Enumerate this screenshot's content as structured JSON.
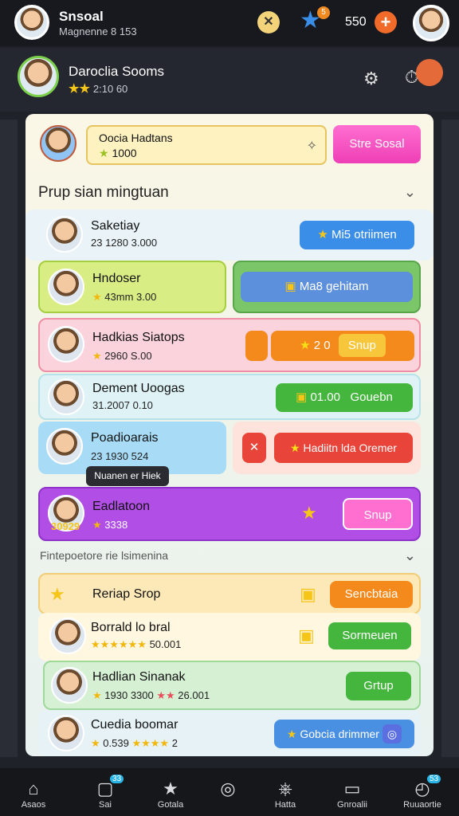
{
  "topbar": {
    "name": "Snsoal",
    "subtitle": "Magnenne 8 153",
    "close": "✕",
    "star_badge": "5",
    "coins": "550",
    "plus": "+"
  },
  "player": {
    "name": "Daroclia Sooms",
    "stars": "★★",
    "level": "2:10 60",
    "gear": "⚙",
    "timer": "⏱"
  },
  "panel": {
    "title": "Oocia Hadtans",
    "value": "1000",
    "send_button": "Stre Sosal"
  },
  "section1": {
    "title": "Prup sian mingtuan",
    "chevron": "⌄"
  },
  "rows": [
    {
      "name": "Saketiay",
      "sub": "23 1280 3.000",
      "button": "Mi5 otriimen"
    },
    {
      "name": "Hndoser",
      "sub": "43mm 3.00",
      "button": "Ma8 gehitam"
    },
    {
      "name": "Hadkias Siatops",
      "sub": "2960 S.00",
      "button": "Snup",
      "count": "2 0"
    },
    {
      "name": "Dement Uoogas",
      "sub": "31.2007 0.10",
      "button": "Gouebn",
      "count": "01.00"
    },
    {
      "name": "Poadioarais",
      "sub": "23 1930 524",
      "button": "Hadiitn lda Oremer",
      "tooltip": "Nuanen er Hiek"
    },
    {
      "name": "Eadlatoon",
      "sub": "3338",
      "level": "30929",
      "button": "Snup"
    }
  ],
  "section2": {
    "title": "Fintepoetore rie lsimenina",
    "chevron": "⌄"
  },
  "rows2": [
    {
      "name": "Reriap Srop",
      "button": "Sencbtaia"
    },
    {
      "name": "Borrald lo bral",
      "sub": "50.001",
      "button": "Sormeuen"
    },
    {
      "name": "Hadlian Sinanak",
      "sub": "1930 3300",
      "sub2": "26.001",
      "button": "Grtup"
    },
    {
      "name": "Cuedia boomar",
      "sub": "0.539",
      "sub2": "2",
      "button": "Gobcia drimmer"
    }
  ],
  "nav": [
    {
      "icon": "⌂",
      "label": "Asaos"
    },
    {
      "icon": "▢",
      "label": "Sai",
      "badge": "33"
    },
    {
      "icon": "★",
      "label": "Gotala"
    },
    {
      "icon": "◎",
      "label": ""
    },
    {
      "icon": "⎈",
      "label": "Hatta"
    },
    {
      "icon": "▭",
      "label": "Gnroalii"
    },
    {
      "icon": "◴",
      "label": "Ruuaortie",
      "badge": "53"
    }
  ],
  "colors": {
    "accent_pink": "#ee3fb6",
    "accent_blue": "#3b8ee8",
    "accent_green": "#45b63d",
    "accent_orange": "#f58a1c",
    "accent_purple": "#b04ee6"
  }
}
